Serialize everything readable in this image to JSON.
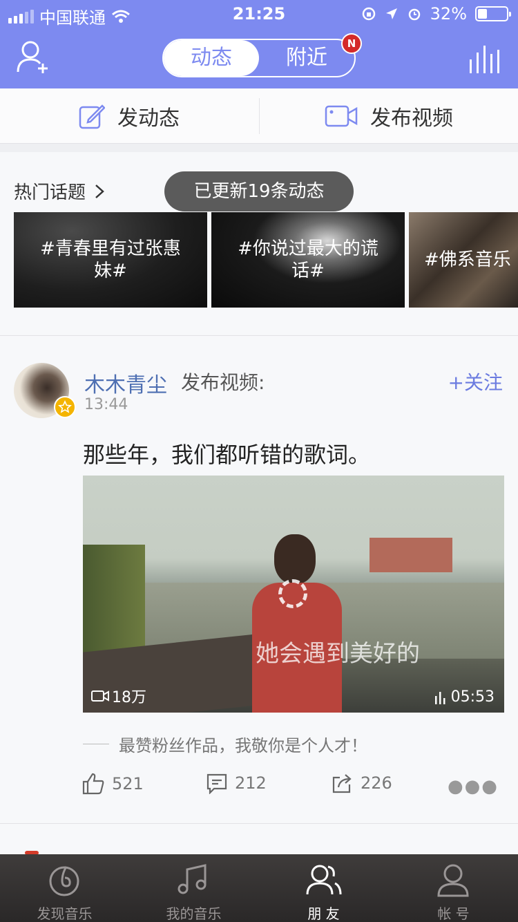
{
  "status_bar": {
    "carrier": "中国联通",
    "time": "21:25",
    "battery": "32%",
    "battery_level": 0.32
  },
  "header": {
    "tabs": [
      {
        "label": "动态",
        "active": true
      },
      {
        "label": "附近",
        "active": false
      }
    ],
    "badge": "N"
  },
  "publish_bar": {
    "post_label": "发动态",
    "video_label": "发布视频"
  },
  "topics": {
    "title": "热门话题",
    "toast": "已更新19条动态",
    "cards": [
      {
        "text": "#青春里有过张惠妹#"
      },
      {
        "text": "#你说过最大的谎话#"
      },
      {
        "text": "#佛系音乐"
      }
    ]
  },
  "post": {
    "author": "木木青尘",
    "action": "发布视频:",
    "follow_label": "+关注",
    "time": "13:44",
    "text": "那些年，我们都听错的歌词。",
    "video": {
      "views": "18万",
      "duration": "05:53",
      "subtitle": "她会遇到美好的"
    },
    "comment": "最赞粉丝作品，我敬你是个人才！",
    "likes": "521",
    "comments": "212",
    "shares": "226"
  },
  "tabbar": {
    "items": [
      {
        "label": "发现音乐",
        "icon": "discover-music-icon",
        "active": false
      },
      {
        "label": "我的音乐",
        "icon": "my-music-icon",
        "active": false
      },
      {
        "label": "朋 友",
        "icon": "friends-icon",
        "active": true
      },
      {
        "label": "帐 号",
        "icon": "account-icon",
        "active": false
      }
    ]
  },
  "colors": {
    "accent": "#7d8af0",
    "author_link": "#4e6fb2",
    "badge_red": "#d42a2a"
  }
}
